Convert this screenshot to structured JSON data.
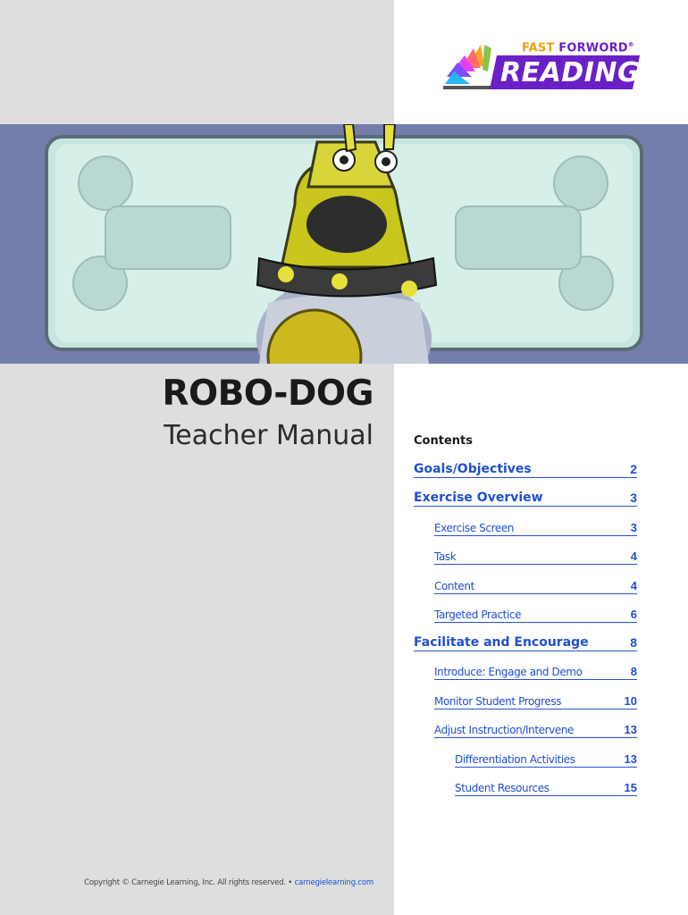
{
  "logo": {
    "top_text_fast": "FAST",
    "top_text_forword": "FORWORD",
    "registered": "®",
    "word": "READING",
    "colors": {
      "purple": "#6a1fc7",
      "orange": "#f39c12"
    }
  },
  "hero": {
    "image_name": "robo-dog-illustration"
  },
  "title": "ROBO-DOG",
  "subtitle": "Teacher Manual",
  "contents": {
    "heading": "Contents",
    "items": [
      {
        "label": "Goals/Objectives",
        "page": "2",
        "level": 1
      },
      {
        "label": "Exercise Overview",
        "page": "3",
        "level": 1
      },
      {
        "label": "Exercise Screen",
        "page": "3",
        "level": 2
      },
      {
        "label": "Task",
        "page": "4",
        "level": 2
      },
      {
        "label": "Content",
        "page": "4",
        "level": 2
      },
      {
        "label": "Targeted Practice",
        "page": "6",
        "level": 2
      },
      {
        "label": "Facilitate and Encourage",
        "page": "8",
        "level": 1
      },
      {
        "label": "Introduce: Engage and Demo",
        "page": "8",
        "level": 2
      },
      {
        "label": "Monitor Student Progress",
        "page": "10",
        "level": 2
      },
      {
        "label": "Adjust Instruction/Intervene",
        "page": "13",
        "level": 2
      },
      {
        "label": "Differentiation Activities",
        "page": "13",
        "level": 3
      },
      {
        "label": "Student Resources",
        "page": "15",
        "level": 3
      }
    ]
  },
  "footer": {
    "copyright": "Copyright © Carnegie Learning, Inc. All rights reserved. •",
    "url": "carnegielearning.com"
  },
  "colors": {
    "link": "#1f4fd0",
    "panel": "#dcdedf"
  }
}
